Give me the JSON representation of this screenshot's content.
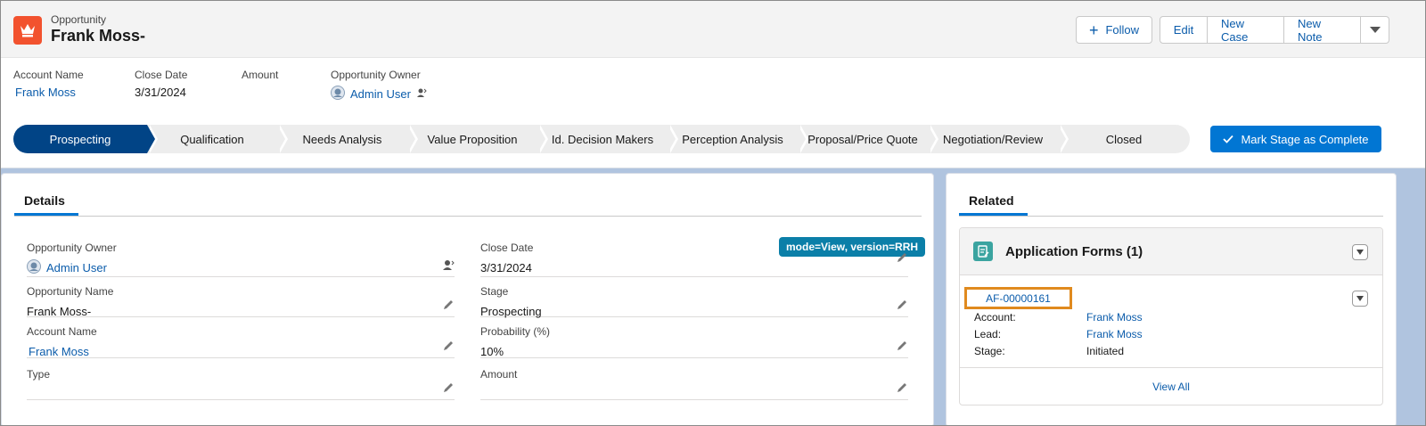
{
  "header": {
    "object_type": "Opportunity",
    "record_title": "Frank Moss-",
    "buttons": {
      "follow": "Follow",
      "edit": "Edit",
      "new_case": "New Case",
      "new_note": "New Note"
    }
  },
  "highlights": [
    {
      "label": "Account Name",
      "value": "Frank Moss"
    },
    {
      "label": "Close Date",
      "value": "3/31/2024"
    },
    {
      "label": "Amount",
      "value": ""
    },
    {
      "label": "Opportunity Owner",
      "value": "Admin User"
    }
  ],
  "path": {
    "stages": [
      "Prospecting",
      "Qualification",
      "Needs Analysis",
      "Value Proposition",
      "Id. Decision Makers",
      "Perception Analysis",
      "Proposal/Price Quote",
      "Negotiation/Review",
      "Closed"
    ],
    "active": "Prospecting",
    "mark_complete_label": "Mark Stage as Complete"
  },
  "details": {
    "tab": "Details",
    "badge": "mode=View, version=RRH",
    "left": [
      {
        "label": "Opportunity Owner",
        "value": "Admin User"
      },
      {
        "label": "Opportunity Name",
        "value": "Frank Moss-"
      },
      {
        "label": "Account Name",
        "value": "Frank Moss"
      },
      {
        "label": "Type",
        "value": ""
      }
    ],
    "right": [
      {
        "label": "Close Date",
        "value": "3/31/2024"
      },
      {
        "label": "Stage",
        "value": "Prospecting"
      },
      {
        "label": "Probability (%)",
        "value": "10%"
      },
      {
        "label": "Amount",
        "value": ""
      }
    ]
  },
  "related": {
    "tab": "Related",
    "list_title": "Application Forms (1)",
    "record": {
      "id": "AF-00000161",
      "fields": [
        {
          "label": "Account:",
          "value": "Frank Moss"
        },
        {
          "label": "Lead:",
          "value": "Frank Moss"
        },
        {
          "label": "Stage:",
          "value": "Initiated"
        }
      ]
    },
    "view_all": "View All"
  }
}
